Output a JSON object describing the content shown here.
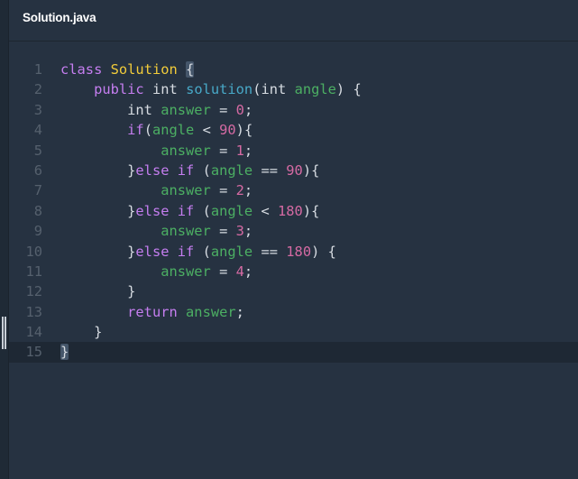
{
  "tab": {
    "title": "Solution.java"
  },
  "editor": {
    "active_line": 15,
    "lines": [
      {
        "n": "1",
        "tokens": [
          {
            "t": "class",
            "c": "kw"
          },
          {
            "t": " ",
            "c": "pl"
          },
          {
            "t": "Solution",
            "c": "cls"
          },
          {
            "t": " ",
            "c": "pl"
          },
          {
            "t": "{",
            "c": "pl",
            "hl": true
          }
        ]
      },
      {
        "n": "2",
        "tokens": [
          {
            "t": "    ",
            "c": "pl"
          },
          {
            "t": "public",
            "c": "kw"
          },
          {
            "t": " ",
            "c": "pl"
          },
          {
            "t": "int",
            "c": "typ"
          },
          {
            "t": " ",
            "c": "pl"
          },
          {
            "t": "solution",
            "c": "fn"
          },
          {
            "t": "(",
            "c": "pl"
          },
          {
            "t": "int",
            "c": "typ"
          },
          {
            "t": " ",
            "c": "pl"
          },
          {
            "t": "angle",
            "c": "var"
          },
          {
            "t": ") {",
            "c": "pl"
          }
        ]
      },
      {
        "n": "3",
        "tokens": [
          {
            "t": "        ",
            "c": "pl"
          },
          {
            "t": "int",
            "c": "typ"
          },
          {
            "t": " ",
            "c": "pl"
          },
          {
            "t": "answer",
            "c": "var"
          },
          {
            "t": " = ",
            "c": "pl"
          },
          {
            "t": "0",
            "c": "num"
          },
          {
            "t": ";",
            "c": "pl"
          }
        ]
      },
      {
        "n": "4",
        "tokens": [
          {
            "t": "        ",
            "c": "pl"
          },
          {
            "t": "if",
            "c": "kw"
          },
          {
            "t": "(",
            "c": "pl"
          },
          {
            "t": "angle",
            "c": "var"
          },
          {
            "t": " < ",
            "c": "pl"
          },
          {
            "t": "90",
            "c": "num"
          },
          {
            "t": "){",
            "c": "pl"
          }
        ]
      },
      {
        "n": "5",
        "tokens": [
          {
            "t": "            ",
            "c": "pl"
          },
          {
            "t": "answer",
            "c": "var"
          },
          {
            "t": " = ",
            "c": "pl"
          },
          {
            "t": "1",
            "c": "num"
          },
          {
            "t": ";",
            "c": "pl"
          }
        ]
      },
      {
        "n": "6",
        "tokens": [
          {
            "t": "        }",
            "c": "pl"
          },
          {
            "t": "else",
            "c": "kw"
          },
          {
            "t": " ",
            "c": "pl"
          },
          {
            "t": "if",
            "c": "kw"
          },
          {
            "t": " (",
            "c": "pl"
          },
          {
            "t": "angle",
            "c": "var"
          },
          {
            "t": " == ",
            "c": "pl"
          },
          {
            "t": "90",
            "c": "num"
          },
          {
            "t": "){",
            "c": "pl"
          }
        ]
      },
      {
        "n": "7",
        "tokens": [
          {
            "t": "            ",
            "c": "pl"
          },
          {
            "t": "answer",
            "c": "var"
          },
          {
            "t": " = ",
            "c": "pl"
          },
          {
            "t": "2",
            "c": "num"
          },
          {
            "t": ";",
            "c": "pl"
          }
        ]
      },
      {
        "n": "8",
        "tokens": [
          {
            "t": "        }",
            "c": "pl"
          },
          {
            "t": "else",
            "c": "kw"
          },
          {
            "t": " ",
            "c": "pl"
          },
          {
            "t": "if",
            "c": "kw"
          },
          {
            "t": " (",
            "c": "pl"
          },
          {
            "t": "angle",
            "c": "var"
          },
          {
            "t": " < ",
            "c": "pl"
          },
          {
            "t": "180",
            "c": "num"
          },
          {
            "t": "){",
            "c": "pl"
          }
        ]
      },
      {
        "n": "9",
        "tokens": [
          {
            "t": "            ",
            "c": "pl"
          },
          {
            "t": "answer",
            "c": "var"
          },
          {
            "t": " = ",
            "c": "pl"
          },
          {
            "t": "3",
            "c": "num"
          },
          {
            "t": ";",
            "c": "pl"
          }
        ]
      },
      {
        "n": "10",
        "tokens": [
          {
            "t": "        }",
            "c": "pl"
          },
          {
            "t": "else",
            "c": "kw"
          },
          {
            "t": " ",
            "c": "pl"
          },
          {
            "t": "if",
            "c": "kw"
          },
          {
            "t": " (",
            "c": "pl"
          },
          {
            "t": "angle",
            "c": "var"
          },
          {
            "t": " == ",
            "c": "pl"
          },
          {
            "t": "180",
            "c": "num"
          },
          {
            "t": ") {",
            "c": "pl"
          }
        ]
      },
      {
        "n": "11",
        "tokens": [
          {
            "t": "            ",
            "c": "pl"
          },
          {
            "t": "answer",
            "c": "var"
          },
          {
            "t": " = ",
            "c": "pl"
          },
          {
            "t": "4",
            "c": "num"
          },
          {
            "t": ";",
            "c": "pl"
          }
        ]
      },
      {
        "n": "12",
        "tokens": [
          {
            "t": "        }",
            "c": "pl"
          }
        ]
      },
      {
        "n": "13",
        "tokens": [
          {
            "t": "        ",
            "c": "pl"
          },
          {
            "t": "return",
            "c": "kw"
          },
          {
            "t": " ",
            "c": "pl"
          },
          {
            "t": "answer",
            "c": "var"
          },
          {
            "t": ";",
            "c": "pl"
          }
        ]
      },
      {
        "n": "14",
        "tokens": [
          {
            "t": "    }",
            "c": "pl"
          }
        ]
      },
      {
        "n": "15",
        "tokens": [
          {
            "t": "}",
            "c": "pl",
            "hl": true
          }
        ]
      }
    ]
  }
}
